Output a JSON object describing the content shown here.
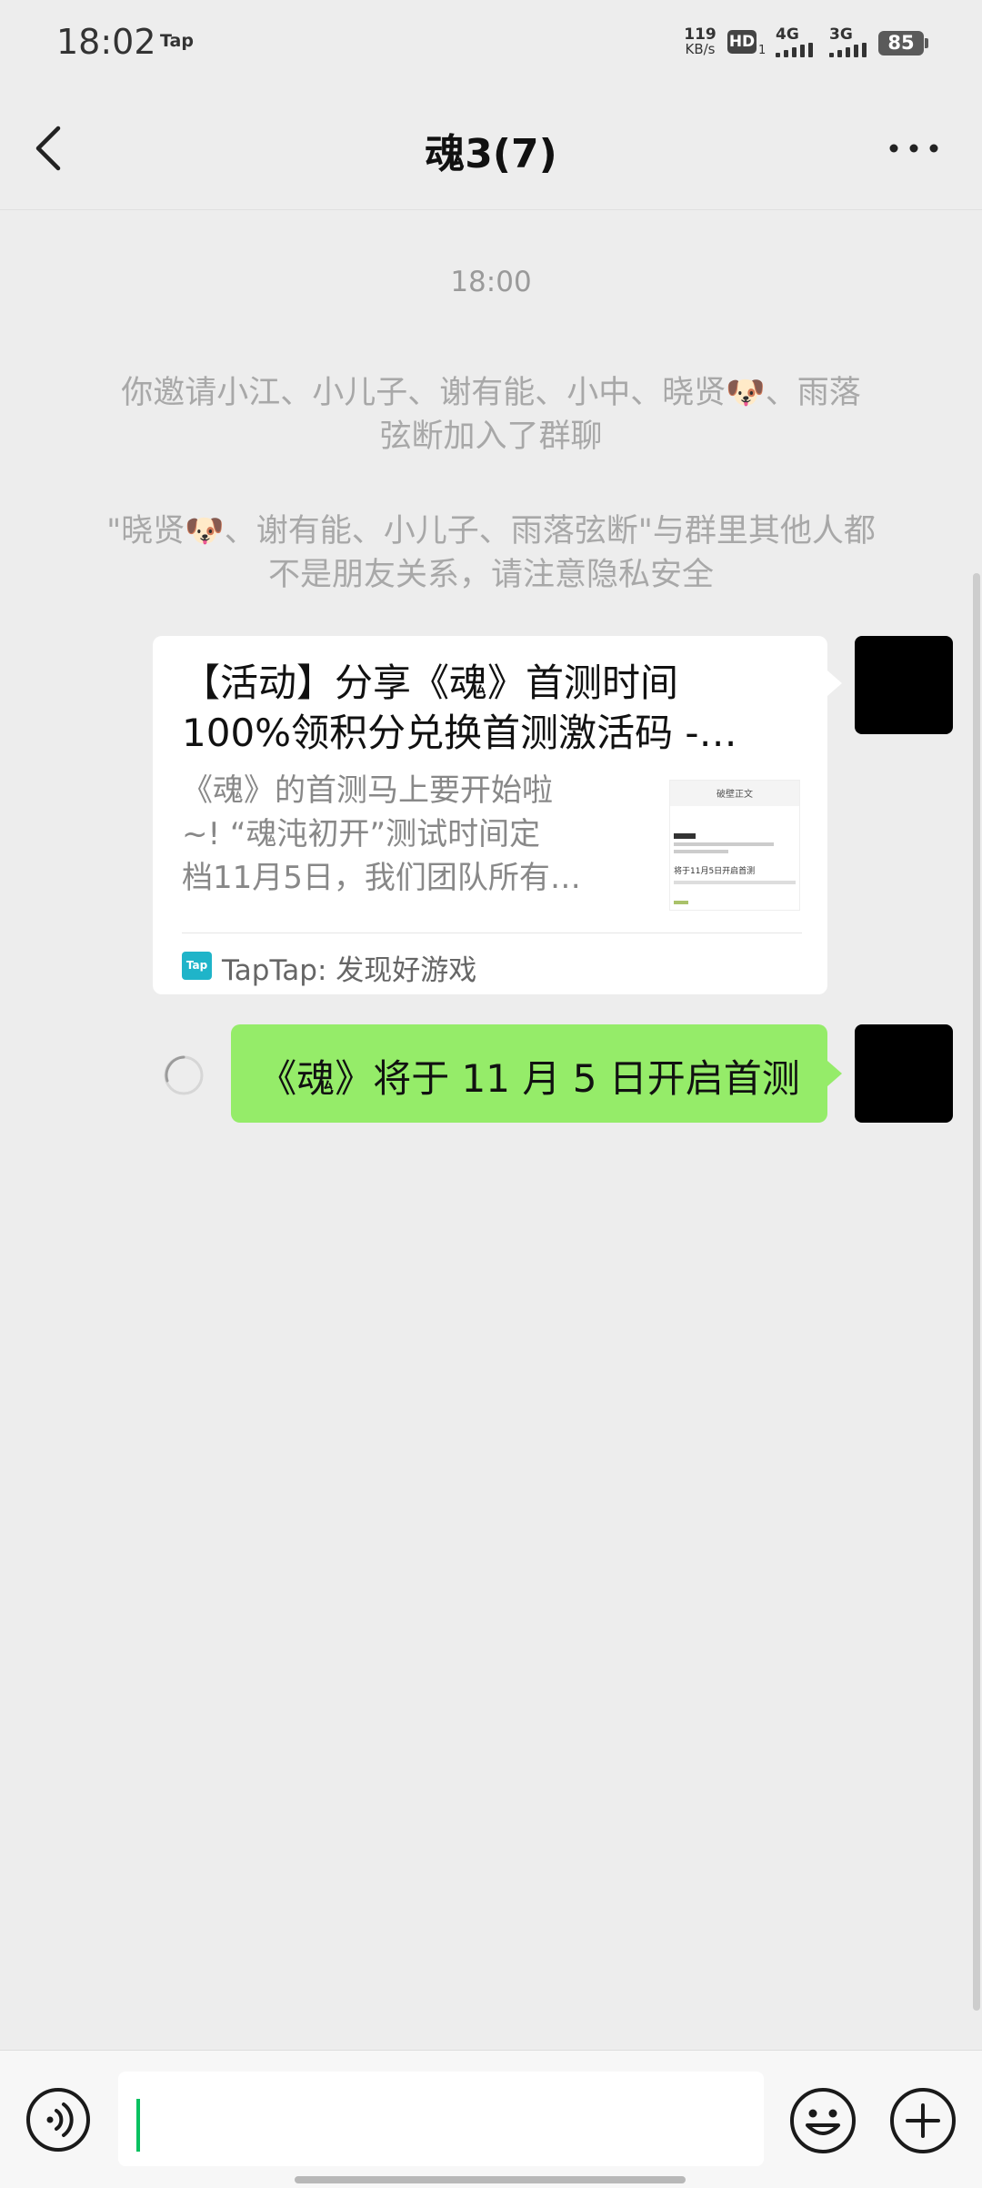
{
  "status_bar": {
    "time": "18:02",
    "app_label": "Tap",
    "speed_value": "119",
    "speed_unit": "KB/s",
    "hd_label": "HD",
    "hd_sub": "1",
    "net1": "4G",
    "net2": "3G",
    "battery": "85"
  },
  "header": {
    "title": "魂3(7)"
  },
  "messages": {
    "timestamp": "18:00",
    "system_invite_l1": "你邀请小江、小儿子、谢有能、小中、晓贤🐶、雨落",
    "system_invite_l2": "弦断加入了群聊",
    "system_warn_l1": "\"晓贤🐶、谢有能、小儿子、雨落弦断\"与群里其他人都",
    "system_warn_l2": "不是朋友关系，请注意隐私安全",
    "card": {
      "title_l1": "【活动】分享《魂》首测时间",
      "title_l2": "100%领积分兑换首测激活码 -…",
      "desc_l1": "《魂》的首测马上要开始啦",
      "desc_l2": "~!  “魂沌初开”测试时间定",
      "desc_l3": "档11月5日，我们团队所有…",
      "thumb_header": "破壁正文",
      "thumb_line": "将于11月5日开启首测",
      "source_icon": "Tap",
      "source": "TapTap: 发现好游戏"
    },
    "sent_text": "《魂》将于 11 月 5 日开启首测"
  },
  "colors": {
    "background": "#ededed",
    "bubble_green": "#95ec69",
    "accent_green": "#07c160",
    "taptap_blue": "#1fb4c9"
  },
  "icons": {
    "back": "chevron-left-icon",
    "more": "more-dots-icon",
    "voice": "voice-icon",
    "emoji": "emoji-icon",
    "plus": "plus-circle-icon",
    "sending": "loading-spinner-icon"
  }
}
